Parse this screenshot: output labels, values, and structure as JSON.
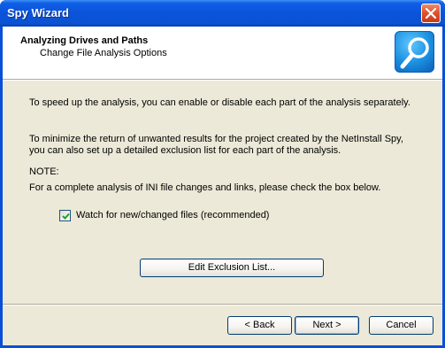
{
  "window": {
    "title": "Spy Wizard"
  },
  "header": {
    "title": "Analyzing Drives and Paths",
    "subtitle": "Change File Analysis Options",
    "icon": "magnifier-icon"
  },
  "body": {
    "paragraph1": "To speed up the analysis, you can enable or disable each part of the analysis separately.",
    "paragraph2": "To minimize the return of unwanted results for the project created by the NetInstall Spy, you can also set up a detailed exclusion list for each part of the analysis.",
    "note_label": "NOTE:",
    "note_text": "For a complete analysis of INI file changes and links, please check the box below.",
    "checkbox": {
      "label": "Watch for new/changed files (recommended)",
      "checked": true
    },
    "edit_button": "Edit Exclusion List..."
  },
  "footer": {
    "back": "< Back",
    "next": "Next >",
    "cancel": "Cancel"
  },
  "colors": {
    "titlebar": "#0a54da",
    "dialog_bg": "#ece9d8",
    "header_bg": "#ffffff",
    "close_button": "#e0542d"
  }
}
